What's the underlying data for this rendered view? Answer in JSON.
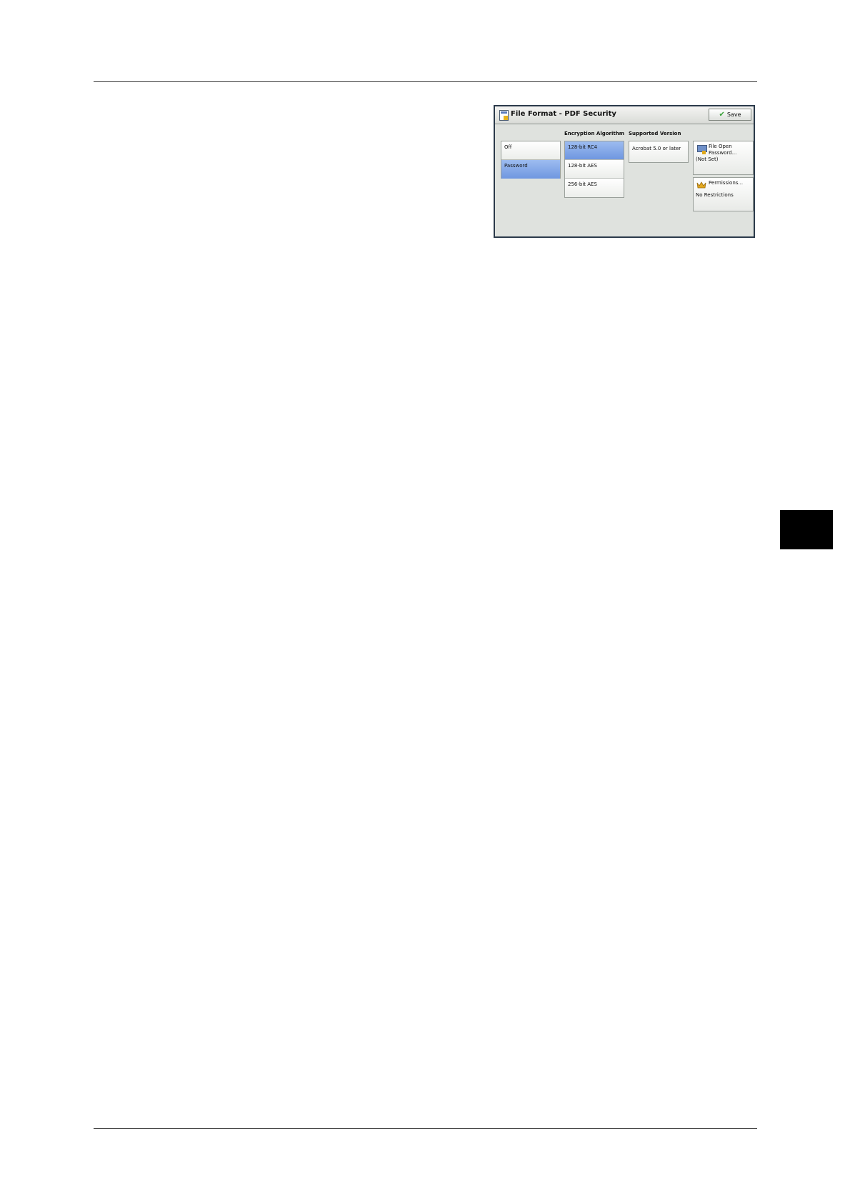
{
  "dialog": {
    "title": "File Format - PDF Security",
    "save_label": "Save",
    "security_options": [
      "Off",
      "Password"
    ],
    "encryption": {
      "label": "Encryption Algorithm",
      "options": [
        "128-bit RC4",
        "128-bit AES",
        "256-bit AES"
      ]
    },
    "version": {
      "label": "Supported Version",
      "value": "Acrobat 5.0 or later"
    },
    "file_open": {
      "line1": "File Open",
      "line2": "Password...",
      "status": "(Not Set)"
    },
    "permissions": {
      "label": "Permissions...",
      "status": "No Restrictions"
    },
    "icons": {
      "title": "pdf-file-icon",
      "save": "checkmark-icon",
      "file_open": "password-monitor-icon",
      "permissions": "crown-icon"
    }
  }
}
